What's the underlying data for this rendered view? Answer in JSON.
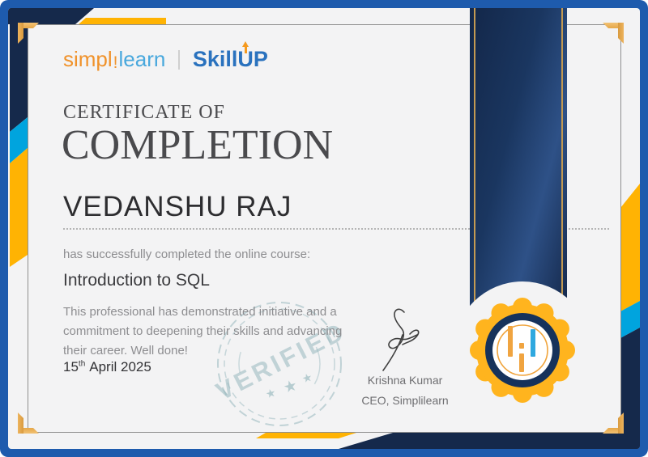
{
  "brand": {
    "wordmark": {
      "part1": "simpl",
      "sep": "!",
      "part2": "learn"
    },
    "product": {
      "part1": "Skill",
      "u": "U",
      "p": "P"
    }
  },
  "certificate": {
    "heading_small": "CERTIFICATE OF",
    "heading_large": "COMPLETION",
    "recipient_name": "VEDANSHU RAJ",
    "completion_text": "has successfully completed the online course:",
    "course_name": "Introduction to SQL",
    "description": "This professional has demonstrated initiative and a\ncommitment to deepening their skills and advancing\ntheir career. Well done!",
    "date": {
      "day": "15",
      "ordinal": "th",
      "month_year": "April 2025"
    },
    "signature": {
      "name": "Krishna Kumar",
      "title": "CEO, Simplilearn"
    },
    "stamp": {
      "label": "VERIFIED",
      "star": "★"
    }
  },
  "colors": {
    "frame_blue": "#1E5BAD",
    "navy": "#15294B",
    "gold": "#FFB303",
    "cyan": "#00A4DE",
    "bracket_gold": "#E5A748",
    "brand_orange": "#F0922B",
    "brand_light_blue": "#49A8DD",
    "skillup_blue": "#2A72BE",
    "badge_gold": "#FFB41E",
    "badge_navy": "#16325B",
    "badge_bar_orange": "#F0A440",
    "badge_bar_blue": "#2FA8DF",
    "stamp_teal": "#8DB2B8",
    "heading_gray": "#4A4A4D",
    "body_gray": "#8D8D90"
  }
}
